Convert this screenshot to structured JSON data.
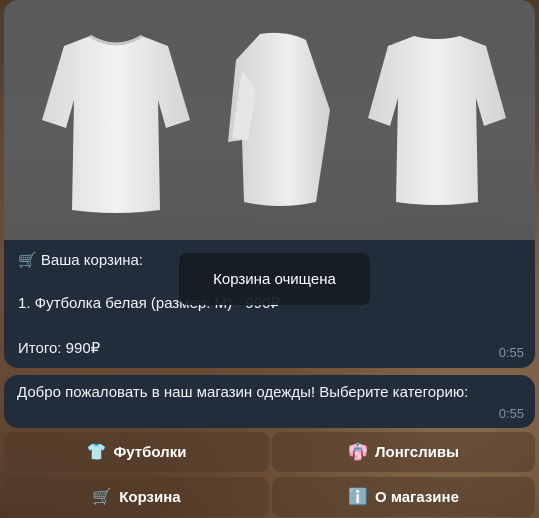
{
  "cart_message": {
    "title_icon": "🛒",
    "title": "Ваша корзина:",
    "item_line": "1. Футболка белая (размер: M) - 990₽",
    "total_line": "Итого: 990₽",
    "time": "0:55",
    "image": "white t-shirt product photo (front, side, back)"
  },
  "welcome_message": {
    "text": "Добро пожаловать в наш магазин одежды! Выберите категорию:",
    "time": "0:55"
  },
  "toast": {
    "text": "Корзина очищена"
  },
  "keyboard": {
    "tshirts": {
      "icon": "👕",
      "label": "Футболки"
    },
    "longsleeves": {
      "icon": "👘",
      "label": "Лонгсливы"
    },
    "cart": {
      "icon": "🛒",
      "label": "Корзина"
    },
    "about": {
      "icon": "ℹ️",
      "label": "О магазине"
    }
  }
}
